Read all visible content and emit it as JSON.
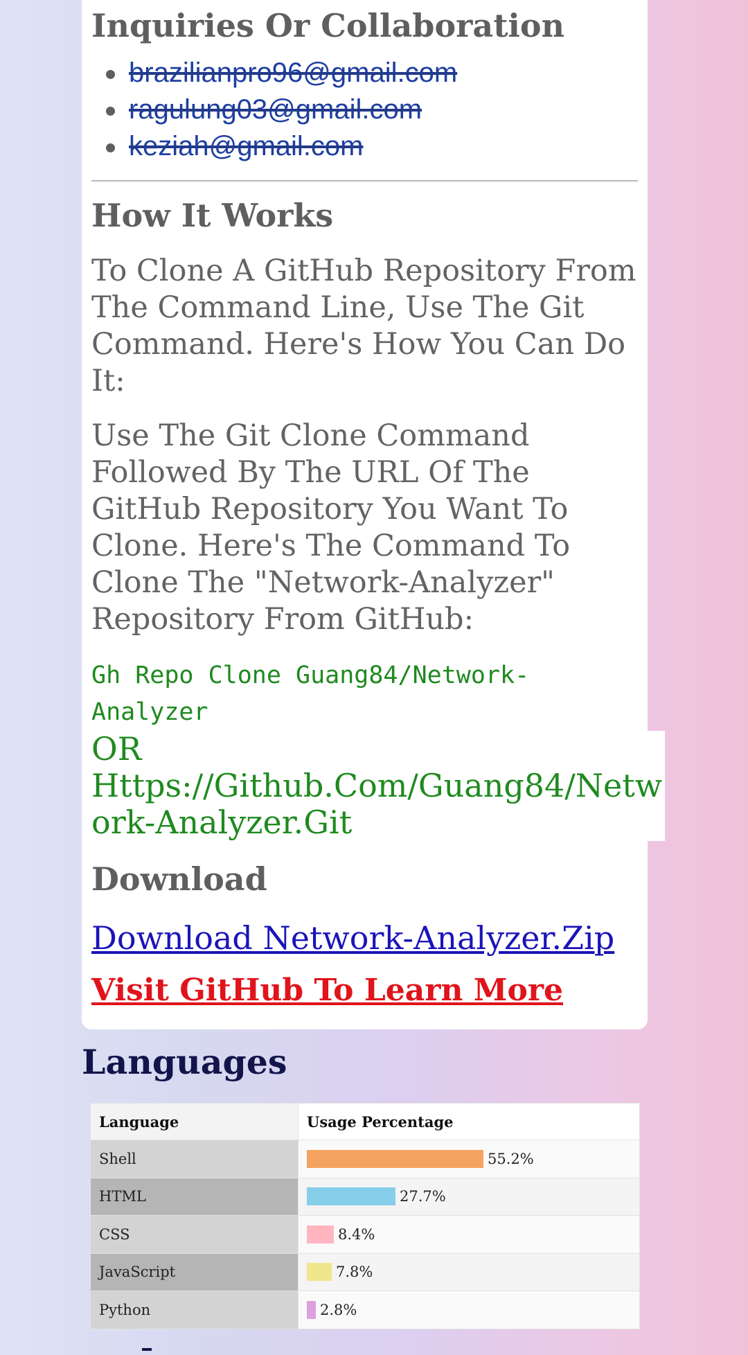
{
  "contact": {
    "heading": "Inquiries Or Collaboration",
    "emails": [
      "brazilianpro96@gmail.com",
      "ragulung03@gmail.com",
      "keziah@gmail.com"
    ]
  },
  "how_it_works": {
    "heading": "How It Works",
    "para1": "To Clone A GitHub Repository From The Command Line, Use The Git Command. Here's How You Can Do It:",
    "para2": "Use The Git Clone Command Followed By The URL Of The GitHub Repository You Want To Clone. Here's The Command To Clone The \"Network-Analyzer\" Repository From GitHub:",
    "command": "Gh Repo Clone Guang84/Network-Analyzer",
    "or_label": "OR",
    "url": "Https://Github.Com/Guang84/Network-Analyzer.Git"
  },
  "download": {
    "heading": "Download",
    "zip_link": "Download Network-Analyzer.Zip",
    "github_link": "Visit GitHub To Learn More"
  },
  "languages": {
    "heading": "Languages",
    "col_language": "Language",
    "col_usage": "Usage Percentage",
    "rows": [
      {
        "name": "Shell",
        "label": "55.2%",
        "value": 55.2,
        "color": "#f4a460"
      },
      {
        "name": "HTML",
        "label": "27.7%",
        "value": 27.7,
        "color": "#87ceeb"
      },
      {
        "name": "CSS",
        "label": "8.4%",
        "value": 8.4,
        "color": "#ffb6c1"
      },
      {
        "name": "JavaScript",
        "label": "7.8%",
        "value": 7.8,
        "color": "#f0e68c"
      },
      {
        "name": "Python",
        "label": "2.8%",
        "value": 2.8,
        "color": "#dda0dd"
      }
    ]
  }
}
